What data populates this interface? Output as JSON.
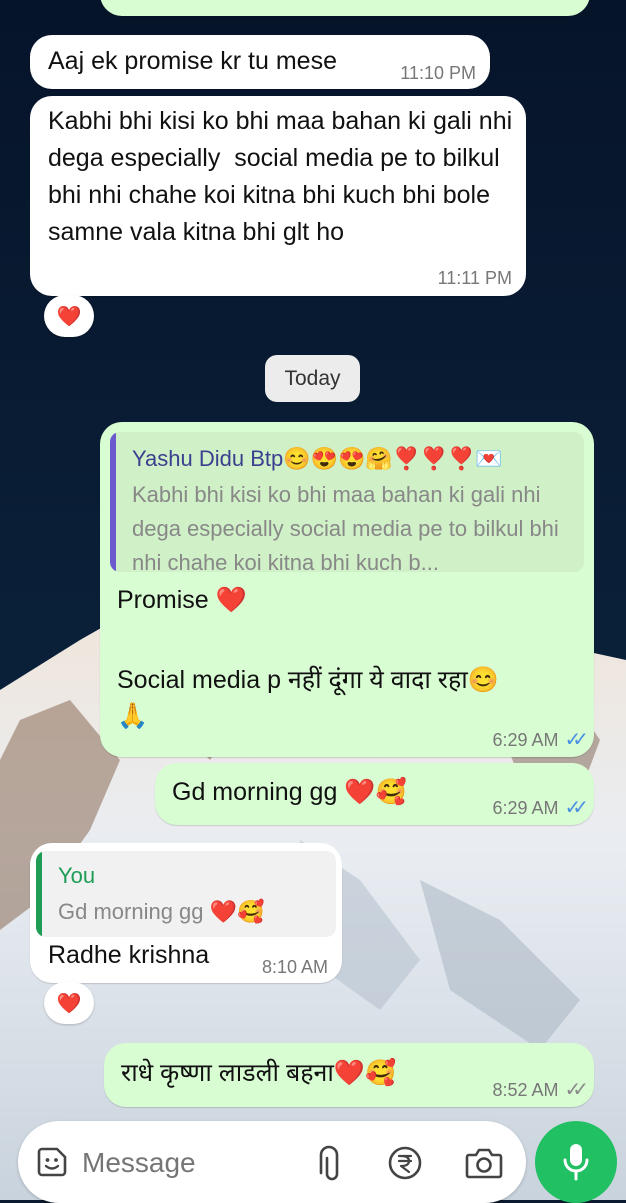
{
  "colors": {
    "incoming_bubble": "#ffffff",
    "outgoing_bubble": "#d9fdd3",
    "read_ticks": "#4a90e2",
    "mic_button": "#21c063",
    "quote_name_contact": "#3b3f8f",
    "quote_name_you": "#1f9d55"
  },
  "date_divider": "Today",
  "messages": [
    {
      "direction": "incoming",
      "text": "Aaj ek promise kr tu mese",
      "time": "11:10 PM"
    },
    {
      "direction": "incoming",
      "text": "Kabhi bhi kisi ko bhi maa bahan ki gali nhi dega especially  social media pe to bilkul bhi nhi chahe koi kitna bhi kuch bhi bole samne vala kitna bhi glt ho",
      "time": "11:11 PM",
      "reaction": "❤️"
    },
    {
      "direction": "outgoing",
      "quote": {
        "name": "Yashu Didu Btp😊😍😍🤗❣️❣️❣️💌",
        "text": "Kabhi bhi kisi ko bhi maa bahan ki gali nhi dega especially  social media pe to bilkul bhi nhi chahe koi kitna bhi kuch b..."
      },
      "text_line1": "Promise ❤️",
      "text_line2": "Social media p नहीं दूंगा ये वादा रहा😊",
      "text_line3": "🙏",
      "time": "6:29 AM",
      "status": "read"
    },
    {
      "direction": "outgoing",
      "text": "Gd morning gg ❤️🥰",
      "time": "6:29 AM",
      "status": "read"
    },
    {
      "direction": "incoming",
      "quote": {
        "name": "You",
        "text": "Gd morning gg ❤️🥰"
      },
      "text": "Radhe krishna",
      "time": "8:10 AM",
      "reaction": "❤️"
    },
    {
      "direction": "outgoing",
      "text": "राधे कृष्णा लाडली बहना❤️🥰",
      "time": "8:52 AM",
      "status": "sent"
    }
  ],
  "composer": {
    "placeholder": "Message",
    "icons": [
      "sticker-icon",
      "attach-icon",
      "rupee-payment-icon",
      "camera-icon",
      "mic-icon"
    ]
  }
}
